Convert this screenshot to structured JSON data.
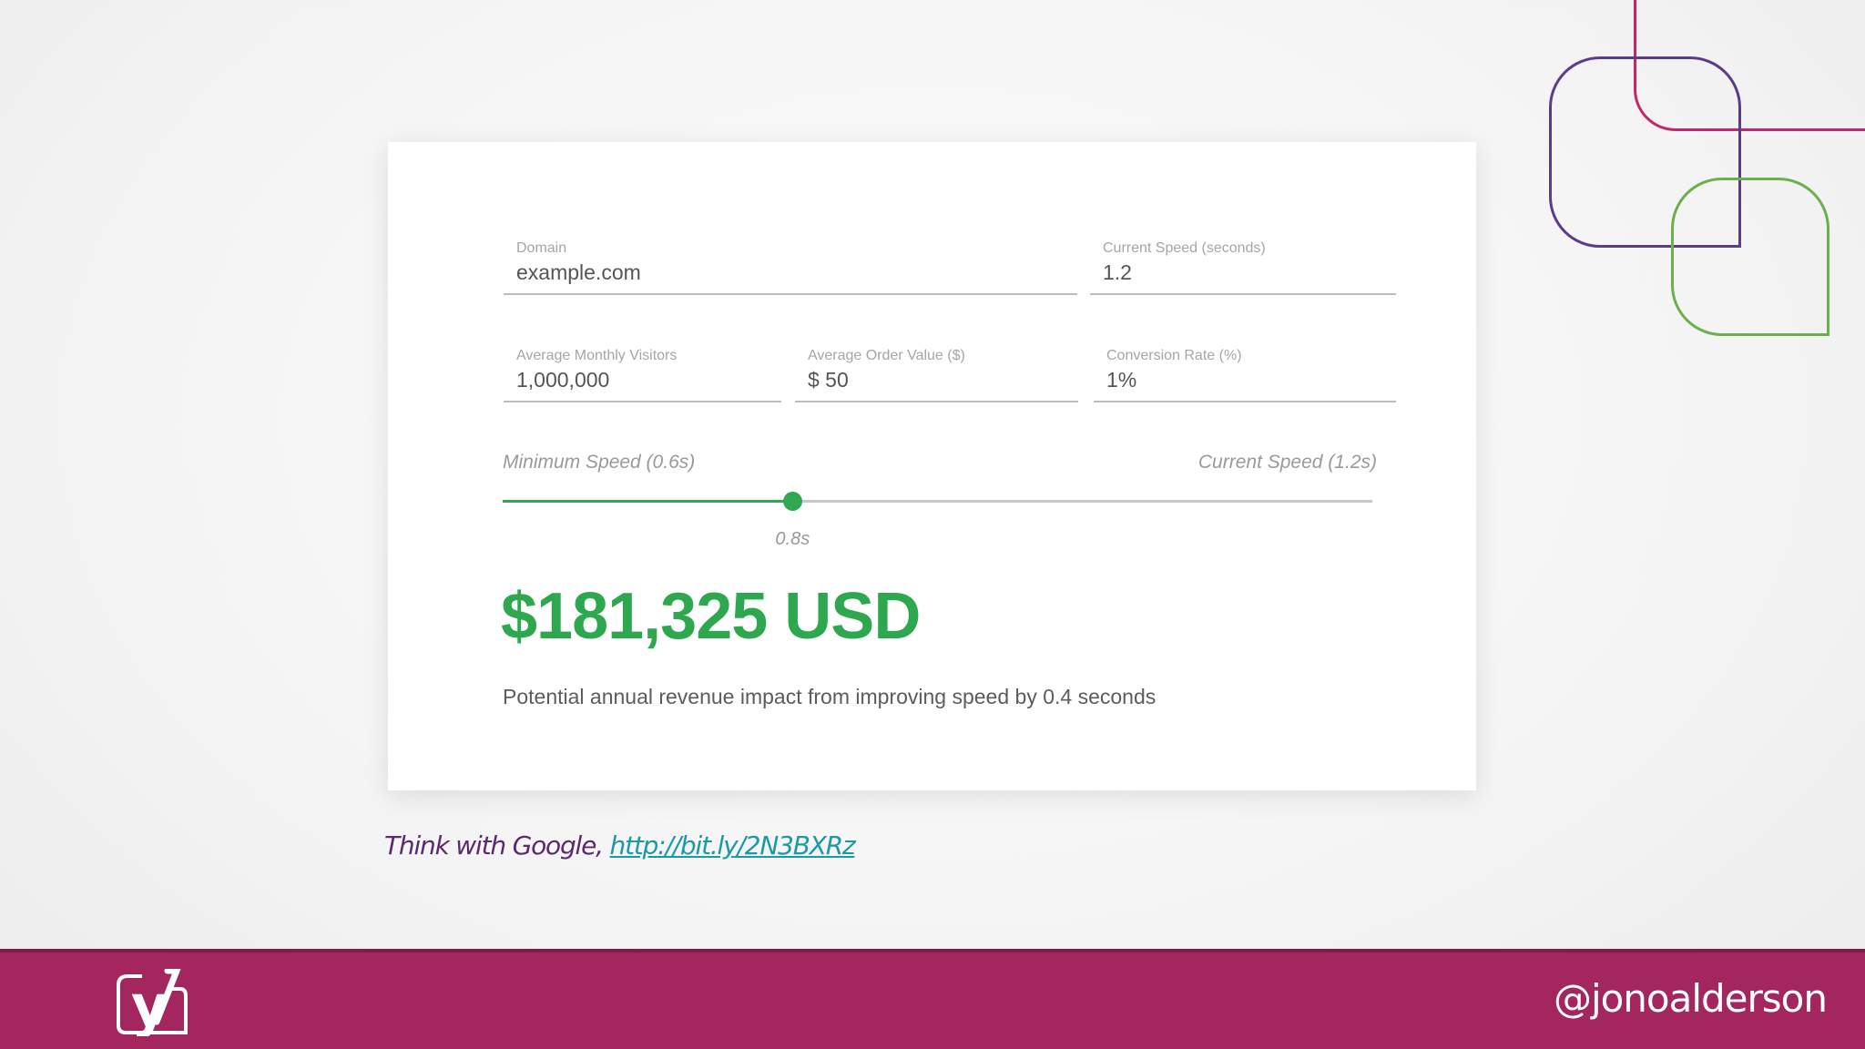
{
  "calculator": {
    "domain": {
      "label": "Domain",
      "value": "example.com"
    },
    "current_speed": {
      "label": "Current Speed (seconds)",
      "value": "1.2"
    },
    "monthly_visitors": {
      "label": "Average Monthly Visitors",
      "value": "1,000,000"
    },
    "order_value": {
      "label": "Average Order Value ($)",
      "value": "$ 50"
    },
    "conversion_rate": {
      "label": "Conversion Rate (%)",
      "value": "1%"
    },
    "slider": {
      "min_label": "Minimum Speed (0.6s)",
      "max_label": "Current Speed (1.2s)",
      "min": 0.6,
      "max": 1.2,
      "value": 0.8,
      "value_label": "0.8s",
      "accent_color": "#2fa84f"
    },
    "result": {
      "amount": "$181,325 USD",
      "description": "Potential annual revenue impact from improving speed by 0.4 seconds",
      "color": "#2ea84e"
    }
  },
  "citation": {
    "prefix": "Think with Google, ",
    "link_text": "http://bit.ly/2N3BXRz"
  },
  "footer": {
    "logo": "yoast-logo-icon",
    "handle": "@jonoalderson",
    "background_color": "#a4265f"
  }
}
